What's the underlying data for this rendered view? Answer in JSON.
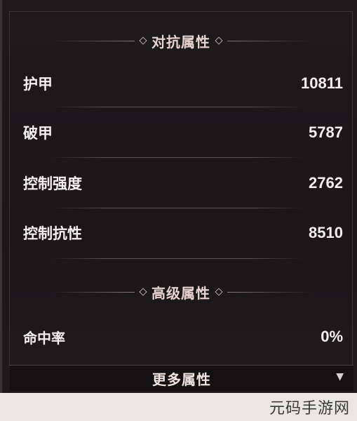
{
  "sections": {
    "resistance": {
      "title": "对抗属性",
      "stats": [
        {
          "label": "护甲",
          "value": "10811"
        },
        {
          "label": "破甲",
          "value": "5787"
        },
        {
          "label": "控制强度",
          "value": "2762"
        },
        {
          "label": "控制抗性",
          "value": "8510"
        }
      ]
    },
    "advanced": {
      "title": "高级属性",
      "stats": [
        {
          "label": "命中率",
          "value": "0%"
        }
      ]
    }
  },
  "more": {
    "label": "更多属性",
    "icon": "triangle-down-icon"
  },
  "watermark": "元码手游网"
}
